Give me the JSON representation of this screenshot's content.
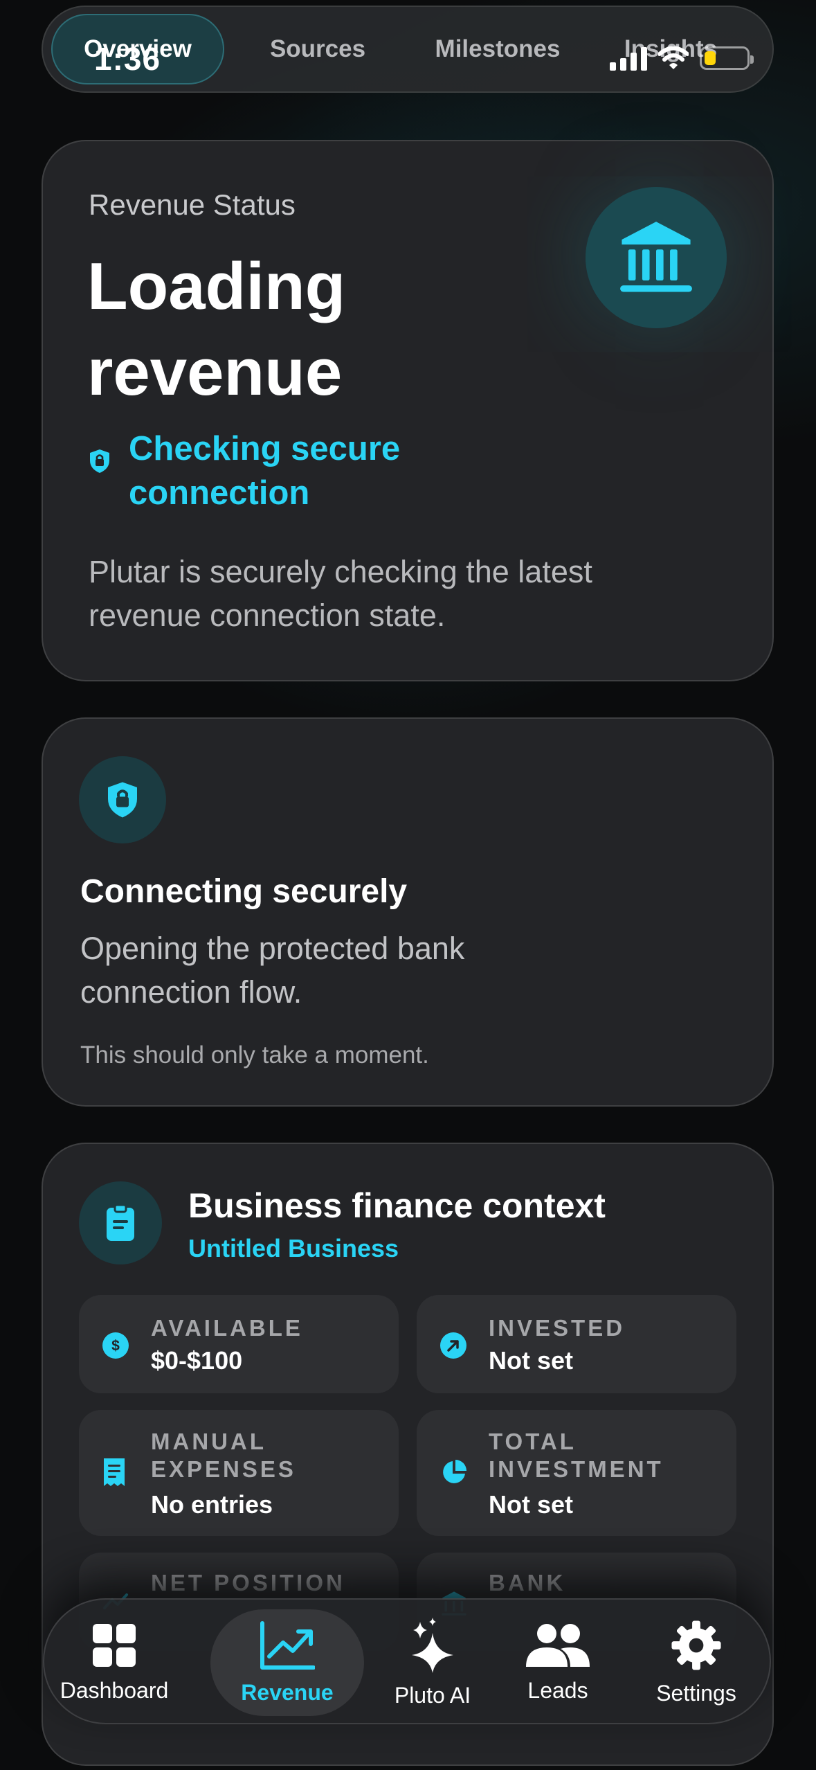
{
  "status_bar": {
    "time": "1:36"
  },
  "top_tabs": [
    {
      "label": "Overview",
      "active": true
    },
    {
      "label": "Sources",
      "active": false
    },
    {
      "label": "Milestones",
      "active": false
    },
    {
      "label": "Insights",
      "active": false
    }
  ],
  "revenue_status": {
    "label": "Revenue Status",
    "title": "Loading revenue",
    "icon": "bank-icon",
    "status_text": "Checking secure connection",
    "description": "Plutar is securely checking the latest revenue connection state."
  },
  "connecting_card": {
    "icon": "shield-lock-icon",
    "title": "Connecting securely",
    "description": "Opening the protected bank connection flow.",
    "note": "This should only take a moment."
  },
  "business_finance": {
    "icon": "clipboard-icon",
    "title": "Business finance context",
    "business_name": "Untitled Business",
    "tiles": [
      {
        "icon": "dollar-icon",
        "label": "AVAILABLE",
        "value": "$0-$100"
      },
      {
        "icon": "arrow-up-right-icon",
        "label": "INVESTED",
        "value": "Not set"
      },
      {
        "icon": "receipt-icon",
        "label": "MANUAL EXPENSES",
        "value": "No entries"
      },
      {
        "icon": "pie-chart-icon",
        "label": "TOTAL INVESTMENT",
        "value": "Not set"
      },
      {
        "icon": "trend-icon",
        "label": "NET POSITION",
        "value": ""
      },
      {
        "icon": "bank-icon",
        "label": "BANK",
        "value": ""
      }
    ]
  },
  "bottom_nav": [
    {
      "icon": "grid-icon",
      "label": "Dashboard",
      "active": false
    },
    {
      "icon": "chart-up-icon",
      "label": "Revenue",
      "active": true
    },
    {
      "icon": "sparkles-icon",
      "label": "Pluto AI",
      "active": false
    },
    {
      "icon": "people-icon",
      "label": "Leads",
      "active": false
    },
    {
      "icon": "gear-icon",
      "label": "Settings",
      "active": false
    }
  ],
  "colors": {
    "accent": "#2ad4f5",
    "background": "#0b0c0d",
    "card": "#232427",
    "tile": "#2e2f32",
    "icon_circle": "#1b3b41",
    "battery": "#ffd60a"
  }
}
